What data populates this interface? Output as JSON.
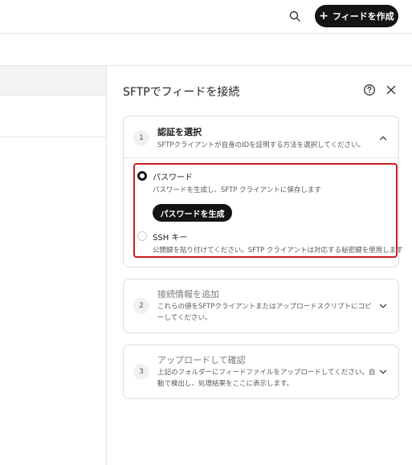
{
  "header": {
    "create_feed_button": "フィードを作成",
    "plus_icon": "plus-icon",
    "search_icon": "search-icon"
  },
  "panel": {
    "title": "SFTPでフィードを接続",
    "help_icon": "help-circle-icon",
    "close_icon": "close-icon"
  },
  "steps": [
    {
      "number": "1",
      "title": "認証を選択",
      "description": "SFTPクライアントが自身のIDを証明する方法を選択してください。",
      "expanded": true,
      "options": [
        {
          "label": "パスワード",
          "description": "パスワードを生成し、SFTP クライアントに保存します",
          "selected": true,
          "button": "パスワードを生成"
        },
        {
          "label": "SSH キー",
          "description": "公開鍵を貼り付けてください。SFTP クライアントは対応する秘密鍵を使用します",
          "selected": false
        }
      ]
    },
    {
      "number": "2",
      "title": "接続情報を追加",
      "description": "これらの値をSFTPクライアントまたはアップロードスクリプトにコピーしてください。",
      "expanded": false
    },
    {
      "number": "3",
      "title": "アップロードして確認",
      "description": "上記のフォルダーにフィードファイルをアップロードしてください。自動で検出し、処理結果をここに表示します。",
      "expanded": false
    }
  ],
  "colors": {
    "primary_button": "#141414",
    "highlight_border": "#c81f1f"
  }
}
